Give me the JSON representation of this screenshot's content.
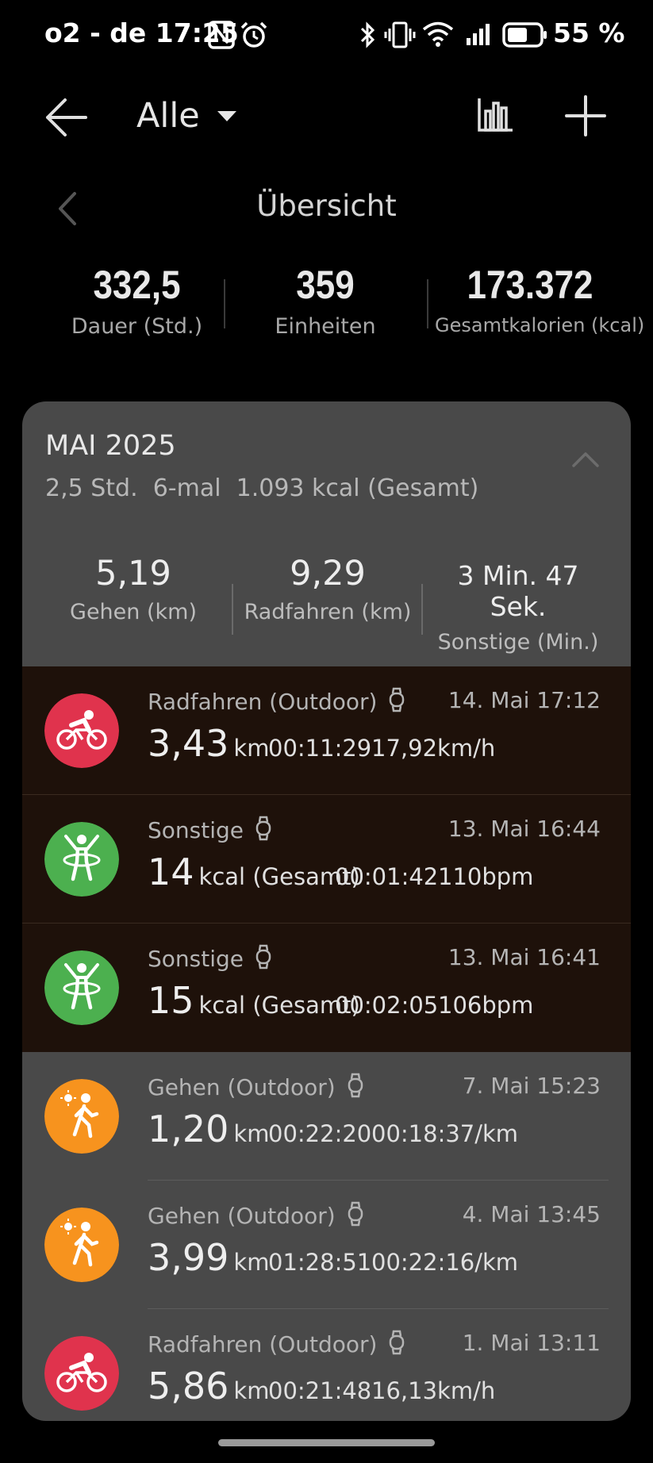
{
  "status_bar": {
    "carrier_time": "o2 - de 17:25",
    "battery": "55 %",
    "icons": [
      "nfc-icon",
      "alarm-icon",
      "bluetooth-icon",
      "vibrate-icon",
      "wifi-icon",
      "signal-icon",
      "battery-icon"
    ]
  },
  "appbar": {
    "filter_label": "Alle",
    "icons": [
      "back-arrow-icon",
      "bar-chart-icon",
      "plus-icon"
    ]
  },
  "overview": {
    "title": "Übersicht",
    "stats": [
      {
        "value": "332,5",
        "label": "Dauer (Std.)"
      },
      {
        "value": "359",
        "label": "Einheiten"
      },
      {
        "value": "173.372",
        "label": "Gesamtkalorien (kcal)"
      }
    ]
  },
  "month": {
    "title": "MAI 2025",
    "summary": "2,5 Std.  6-mal  1.093 kcal (Gesamt)",
    "stats": [
      {
        "value": "5,19",
        "label": "Gehen (km)"
      },
      {
        "value": "9,29",
        "label": "Radfahren (km)"
      },
      {
        "value": "3 Min. 47 Sek.",
        "label": "Sonstige (Min.)"
      }
    ]
  },
  "activities": [
    {
      "type": "Radfahren (Outdoor)",
      "date": "14. Mai 17:12",
      "value": "3,43",
      "unit": "km",
      "duration": "00:11:29",
      "extra": "17,92km/h",
      "icon": "cycling-icon",
      "color": "#e0334d"
    },
    {
      "type": "Sonstige",
      "date": "13. Mai 16:44",
      "value": "14",
      "unit": "kcal (Gesamt)",
      "duration": "00:01:42",
      "extra": "110bpm",
      "icon": "hula-hoop-icon",
      "color": "#4cb04f"
    },
    {
      "type": "Sonstige",
      "date": "13. Mai 16:41",
      "value": "15",
      "unit": "kcal (Gesamt)",
      "duration": "00:02:05",
      "extra": "106bpm",
      "icon": "hula-hoop-icon",
      "color": "#4cb04f"
    },
    {
      "type": "Gehen (Outdoor)",
      "date": "7. Mai 15:23",
      "value": "1,20",
      "unit": "km",
      "duration": "00:22:20",
      "extra": "00:18:37/km",
      "icon": "walking-icon",
      "color": "#f7931e"
    },
    {
      "type": "Gehen (Outdoor)",
      "date": "4. Mai 13:45",
      "value": "3,99",
      "unit": "km",
      "duration": "01:28:51",
      "extra": "00:22:16/km",
      "icon": "walking-icon",
      "color": "#f7931e"
    },
    {
      "type": "Radfahren (Outdoor)",
      "date": "1. Mai 13:11",
      "value": "5,86",
      "unit": "km",
      "duration": "00:21:48",
      "extra": "16,13km/h",
      "icon": "cycling-icon",
      "color": "#e0334d"
    }
  ]
}
